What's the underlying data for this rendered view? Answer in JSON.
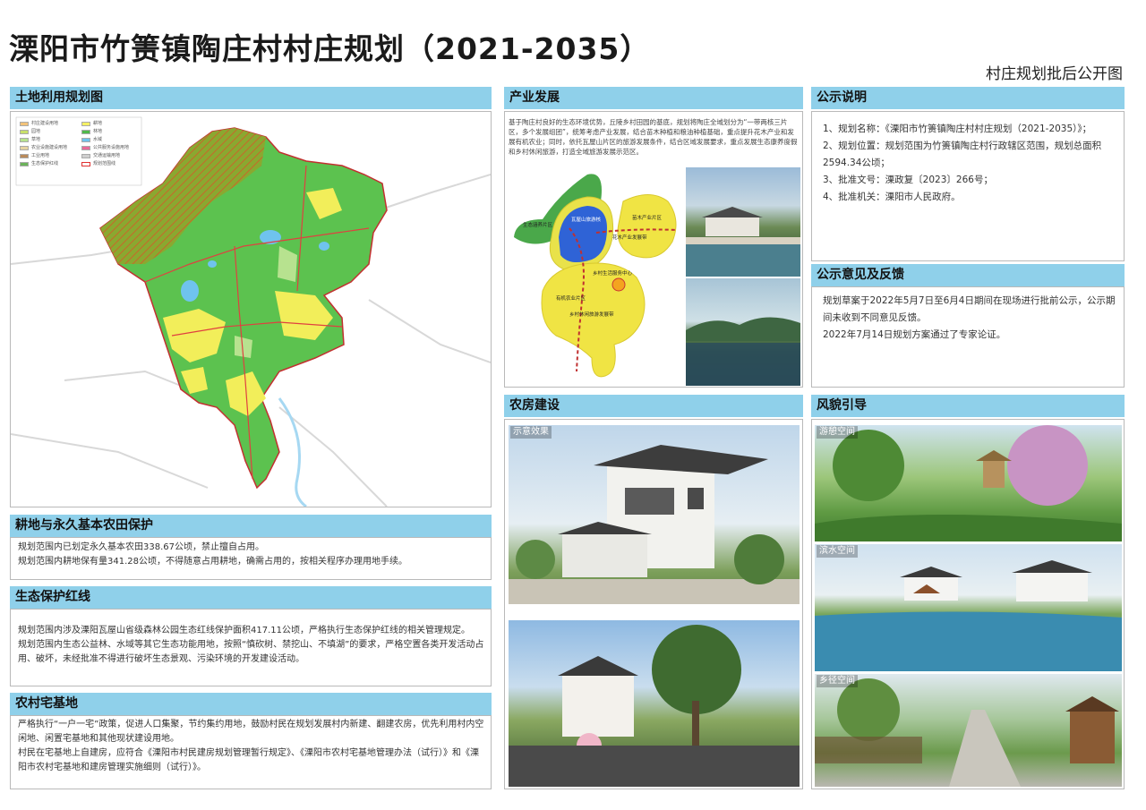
{
  "page": {
    "title": "溧阳市竹箦镇陶庄村村庄规划（2021-2035）",
    "subtitle": "村庄规划批后公开图"
  },
  "sections": {
    "land_use": {
      "heading": "土地利用规划图"
    },
    "farmland": {
      "heading": "耕地与永久基本农田保护",
      "lines": [
        "规划范围内已划定永久基本农田338.67公顷，禁止擅自占用。",
        "规划范围内耕地保有量341.28公顷，不得随意占用耕地，确需占用的，按相关程序办理用地手续。"
      ]
    },
    "eco": {
      "heading": "生态保护红线",
      "lines": [
        "规划范围内涉及溧阳瓦屋山省级森林公园生态红线保护面积417.11公顷，严格执行生态保护红线的相关管理规定。",
        "规划范围内生态公益林、水域等其它生态功能用地，按照“慎砍树、禁挖山、不填湖”的要求，严格空置各类开发活动占用、破坏，未经批准不得进行破坏生态景观、污染环境的开发建设活动。"
      ]
    },
    "homestead": {
      "heading": "农村宅基地",
      "lines": [
        "严格执行“一户一宅”政策，促进人口集聚，节约集约用地，鼓励村民在规划发展村内新建、翻建农房，优先利用村内空闲地、闲置宅基地和其他现状建设用地。",
        "村民在宅基地上自建房，应符合《溧阳市村民建房规划管理暂行规定》、《溧阳市农村宅基地管理办法（试行）》和《溧阳市农村宅基地和建房管理实施细则（试行）》。"
      ]
    },
    "industry": {
      "heading": "产业发展",
      "text": "基于陶庄村良好的生态环境优势，丘陵乡村田园的基底，规划将陶庄全域划分为“一带两核三片区，多个发展组团”，统筹考虑产业发展，结合苗木种植和粮油种植基础，重点提升花木产业和发展有机农业；同时，依托瓦屋山片区的旅游发展条件，结合区域发展要求，重点发展生态康养度假和乡村休闲旅游，打造全域旅游发展示范区。",
      "zone_labels": [
        "生态涵养片区",
        "瓦屋山旅游核",
        "苗木产业片区",
        "乡村生活服务中心",
        "有机农业片区",
        "乡村休闲旅游发展带",
        "花木产业发展带"
      ]
    },
    "notice": {
      "heading": "公示说明",
      "lines": [
        "1、规划名称：《溧阳市竹箦镇陶庄村村庄规划（2021-2035）》；",
        "2、规划位置：规划范围为竹箦镇陶庄村行政辖区范围，规划总面积2594.34公顷；",
        "3、批准文号：溧政复〔2023〕266号；",
        "4、批准机关：溧阳市人民政府。"
      ]
    },
    "feedback": {
      "heading": "公示意见及反馈",
      "lines": [
        "规划草案于2022年5月7日至6月4日期间在现场进行批前公示，公示期间未收到不同意见反馈。",
        "2022年7月14日规划方案通过了专家论证。"
      ]
    },
    "housing": {
      "heading": "农房建设",
      "image_label": "示意效果"
    },
    "landscape": {
      "heading": "风貌引导",
      "image_labels": [
        "游憩空间",
        "滨水空间",
        "乡径空间"
      ]
    }
  },
  "legend": [
    {
      "label": "村庄建设用地",
      "color": "#f2c27a"
    },
    {
      "label": "耕地",
      "color": "#f5f064"
    },
    {
      "label": "园地",
      "color": "#c8e06a"
    },
    {
      "label": "林地",
      "color": "#4fb84a"
    },
    {
      "label": "草地",
      "color": "#b7e28f"
    },
    {
      "label": "水域",
      "color": "#6fc3ee"
    },
    {
      "label": "农业设施建设用地",
      "color": "#e6d3a1"
    },
    {
      "label": "公共服务设施用地",
      "color": "#e86a9a"
    },
    {
      "label": "工业用地",
      "color": "#b98a5a"
    },
    {
      "label": "交通运输用地",
      "color": "#cfcfcf"
    },
    {
      "label": "生态保护红线",
      "color": "#6bb35a"
    },
    {
      "label": "规划范围线",
      "color": "#e03030"
    }
  ],
  "colors": {
    "header_bg": "#8fd0ea",
    "forest": "#4fb84a",
    "farmland": "#f5f064",
    "water": "#6fc3ee",
    "boundary": "#e03030"
  }
}
